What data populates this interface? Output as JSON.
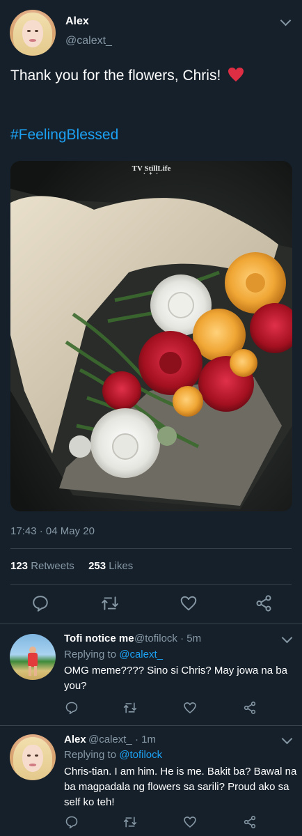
{
  "main_tweet": {
    "author_name": "Alex",
    "author_handle": "@calext_",
    "text": "Thank you for the flowers, Chris!",
    "emoji": "red-heart",
    "hashtag": "#FeelingBlessed",
    "photo_watermark": "TV StillLife",
    "photo_watermark_dots": "• ✦ •",
    "timestamp": "17:43 · 04 May 20",
    "retweets_count": "123",
    "retweets_label": "Retweets",
    "likes_count": "253",
    "likes_label": "Likes",
    "actions": [
      "reply-icon",
      "retweet-icon",
      "like-icon",
      "share-icon"
    ]
  },
  "replies": [
    {
      "author_name": "Tofi notice me",
      "author_handle": "@tofilock",
      "time": "· 5m",
      "replying_to_label": "Replying to",
      "replying_to_handle": "@calext_",
      "text": "OMG meme???? Sino si Chris? May jowa na ba you?"
    },
    {
      "author_name": "Alex",
      "author_handle": "@calext_",
      "time": "· 1m",
      "replying_to_label": "Replying to",
      "replying_to_handle": "@tofilock",
      "text": "Chris-tian. I am him. He is me. Bakit ba? Bawal na ba magpadala ng flowers sa sarili? Proud ako sa self ko teh!"
    }
  ],
  "colors": {
    "background": "#15202b",
    "accent": "#1da1f2",
    "secondary_text": "#8899a6",
    "divider": "#38444d",
    "heart": "#e0245e"
  }
}
